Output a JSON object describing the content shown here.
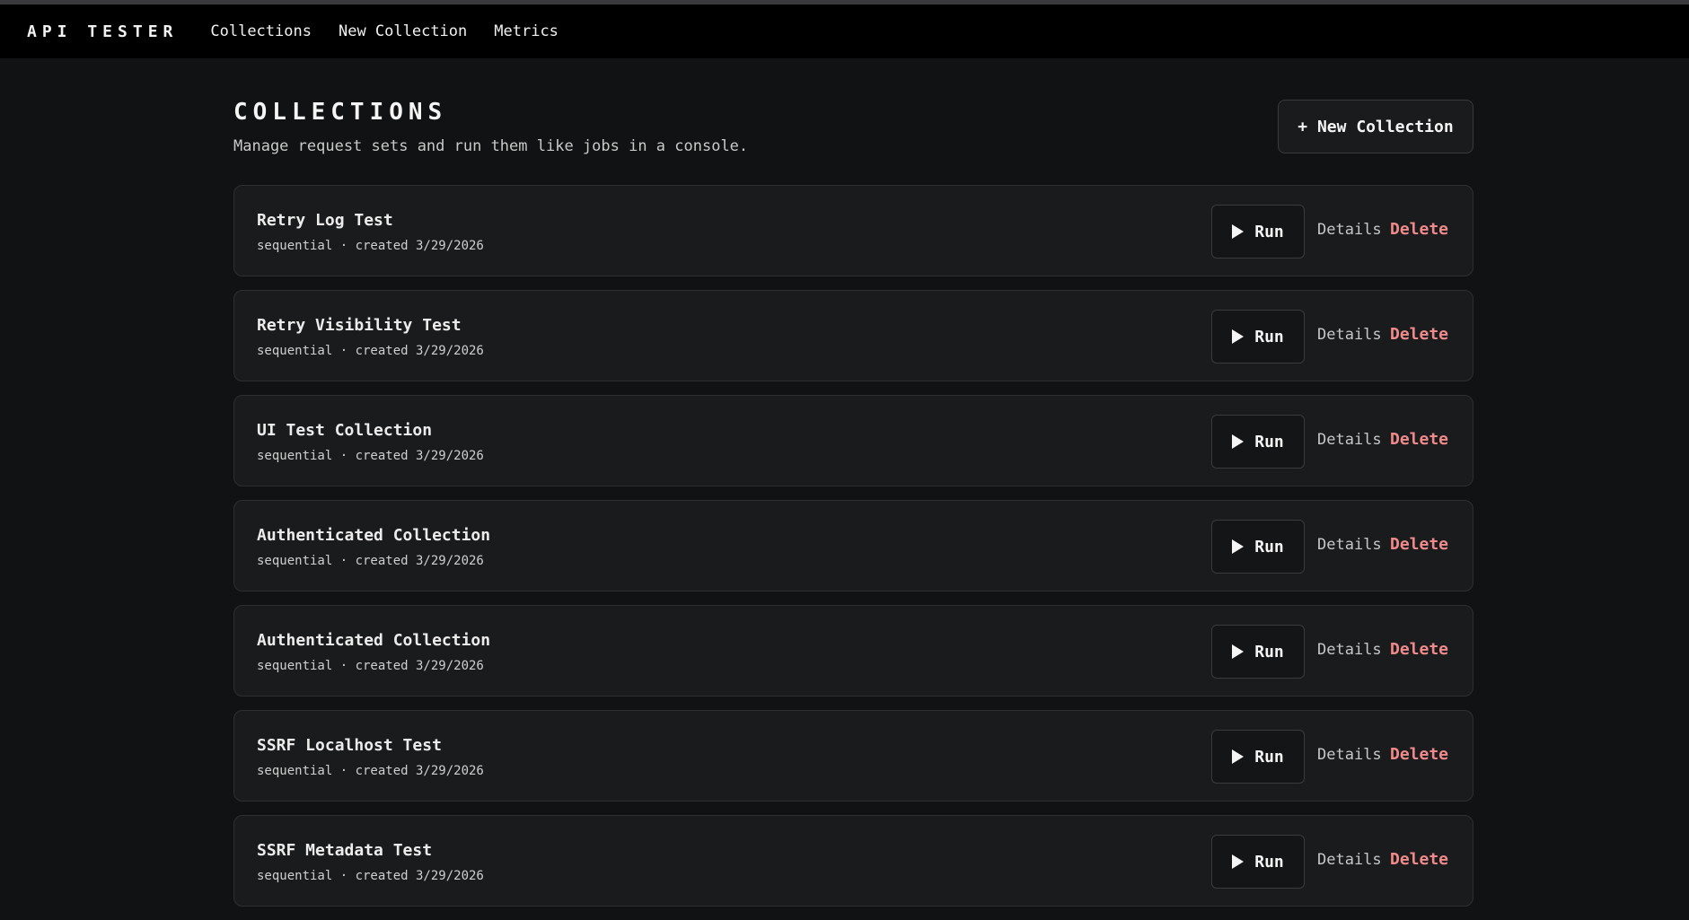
{
  "nav": {
    "brand": "API TESTER",
    "links": [
      "Collections",
      "New Collection",
      "Metrics"
    ]
  },
  "header": {
    "title": "COLLECTIONS",
    "subtitle": "Manage request sets and run them like jobs in a console.",
    "new_button": "+ New Collection"
  },
  "actions": {
    "run": "Run",
    "details": "Details",
    "delete": "Delete"
  },
  "collections": [
    {
      "name": "Retry Log Test",
      "meta": "sequential · created 3/29/2026"
    },
    {
      "name": "Retry Visibility Test",
      "meta": "sequential · created 3/29/2026"
    },
    {
      "name": "UI Test Collection",
      "meta": "sequential · created 3/29/2026"
    },
    {
      "name": "Authenticated Collection",
      "meta": "sequential · created 3/29/2026"
    },
    {
      "name": "Authenticated Collection",
      "meta": "sequential · created 3/29/2026"
    },
    {
      "name": "SSRF Localhost Test",
      "meta": "sequential · created 3/29/2026"
    },
    {
      "name": "SSRF Metadata Test",
      "meta": "sequential · created 3/29/2026"
    }
  ],
  "colors": {
    "background": "#111213",
    "topbar": "#000000",
    "card": "#1a1b1d",
    "delete": "#f08a8a"
  }
}
